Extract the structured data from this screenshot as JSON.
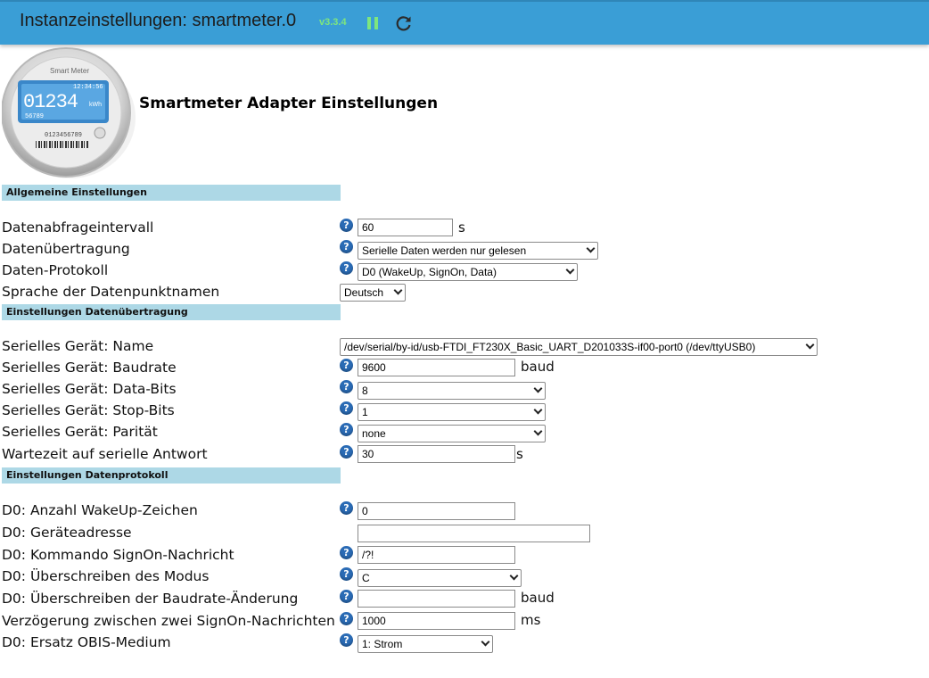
{
  "header": {
    "title": "Instanzeinstellungen: smartmeter.0",
    "version": "v3.3.4"
  },
  "logo": {
    "brand": "Smart Meter",
    "reading": "01234",
    "unit": "kWh",
    "time": "12:34:56",
    "sub": "56789",
    "serial": "0123456789"
  },
  "page_title": "Smartmeter Adapter Einstellungen",
  "sections": {
    "general": "Allgemeine Einstellungen",
    "transfer": "Einstellungen Datenübertragung",
    "protocol": "Einstellungen Datenprotokoll"
  },
  "fields": {
    "interval": {
      "label": "Datenabfrageintervall",
      "value": "60",
      "unit": "s"
    },
    "transfer": {
      "label": "Datenübertragung",
      "value": "Serielle Daten werden nur gelesen"
    },
    "protocol": {
      "label": "Daten-Protokoll",
      "value": "D0 (WakeUp, SignOn, Data)"
    },
    "language": {
      "label": "Sprache der Datenpunktnamen",
      "value": "Deutsch"
    },
    "serial_name": {
      "label": "Serielles Gerät: Name",
      "value": "/dev/serial/by-id/usb-FTDI_FT230X_Basic_UART_D201033S-if00-port0 (/dev/ttyUSB0)"
    },
    "baudrate": {
      "label": "Serielles Gerät: Baudrate",
      "value": "9600",
      "unit": "baud"
    },
    "databits": {
      "label": "Serielles Gerät: Data-Bits",
      "value": "8"
    },
    "stopbits": {
      "label": "Serielles Gerät: Stop-Bits",
      "value": "1"
    },
    "parity": {
      "label": "Serielles Gerät: Parität",
      "value": "none"
    },
    "wait": {
      "label": "Wartezeit auf serielle Antwort",
      "value": "30",
      "unit": "s"
    },
    "wakeup_count": {
      "label": "D0: Anzahl WakeUp-Zeichen",
      "value": "0"
    },
    "device_address": {
      "label": "D0: Geräteadresse",
      "value": ""
    },
    "signon_cmd": {
      "label": "D0: Kommando SignOn-Nachricht",
      "value": "/?!"
    },
    "mode_override": {
      "label": "D0: Überschreiben des Modus",
      "value": "C"
    },
    "baud_override": {
      "label": "D0: Überschreiben der Baudrate-Änderung",
      "value": "",
      "unit": "baud"
    },
    "signon_delay": {
      "label": "Verzögerung zwischen zwei SignOn-Nachrichten",
      "value": "1000",
      "unit": "ms"
    },
    "obis_medium": {
      "label": "D0: Ersatz OBIS-Medium",
      "value": "1: Strom"
    }
  },
  "help_glyph": "?",
  "colors": {
    "topbar": "#3a9ed6",
    "section_bg": "#add8e6",
    "help_icon": "#2a6bb5",
    "version": "#7ee67e"
  }
}
